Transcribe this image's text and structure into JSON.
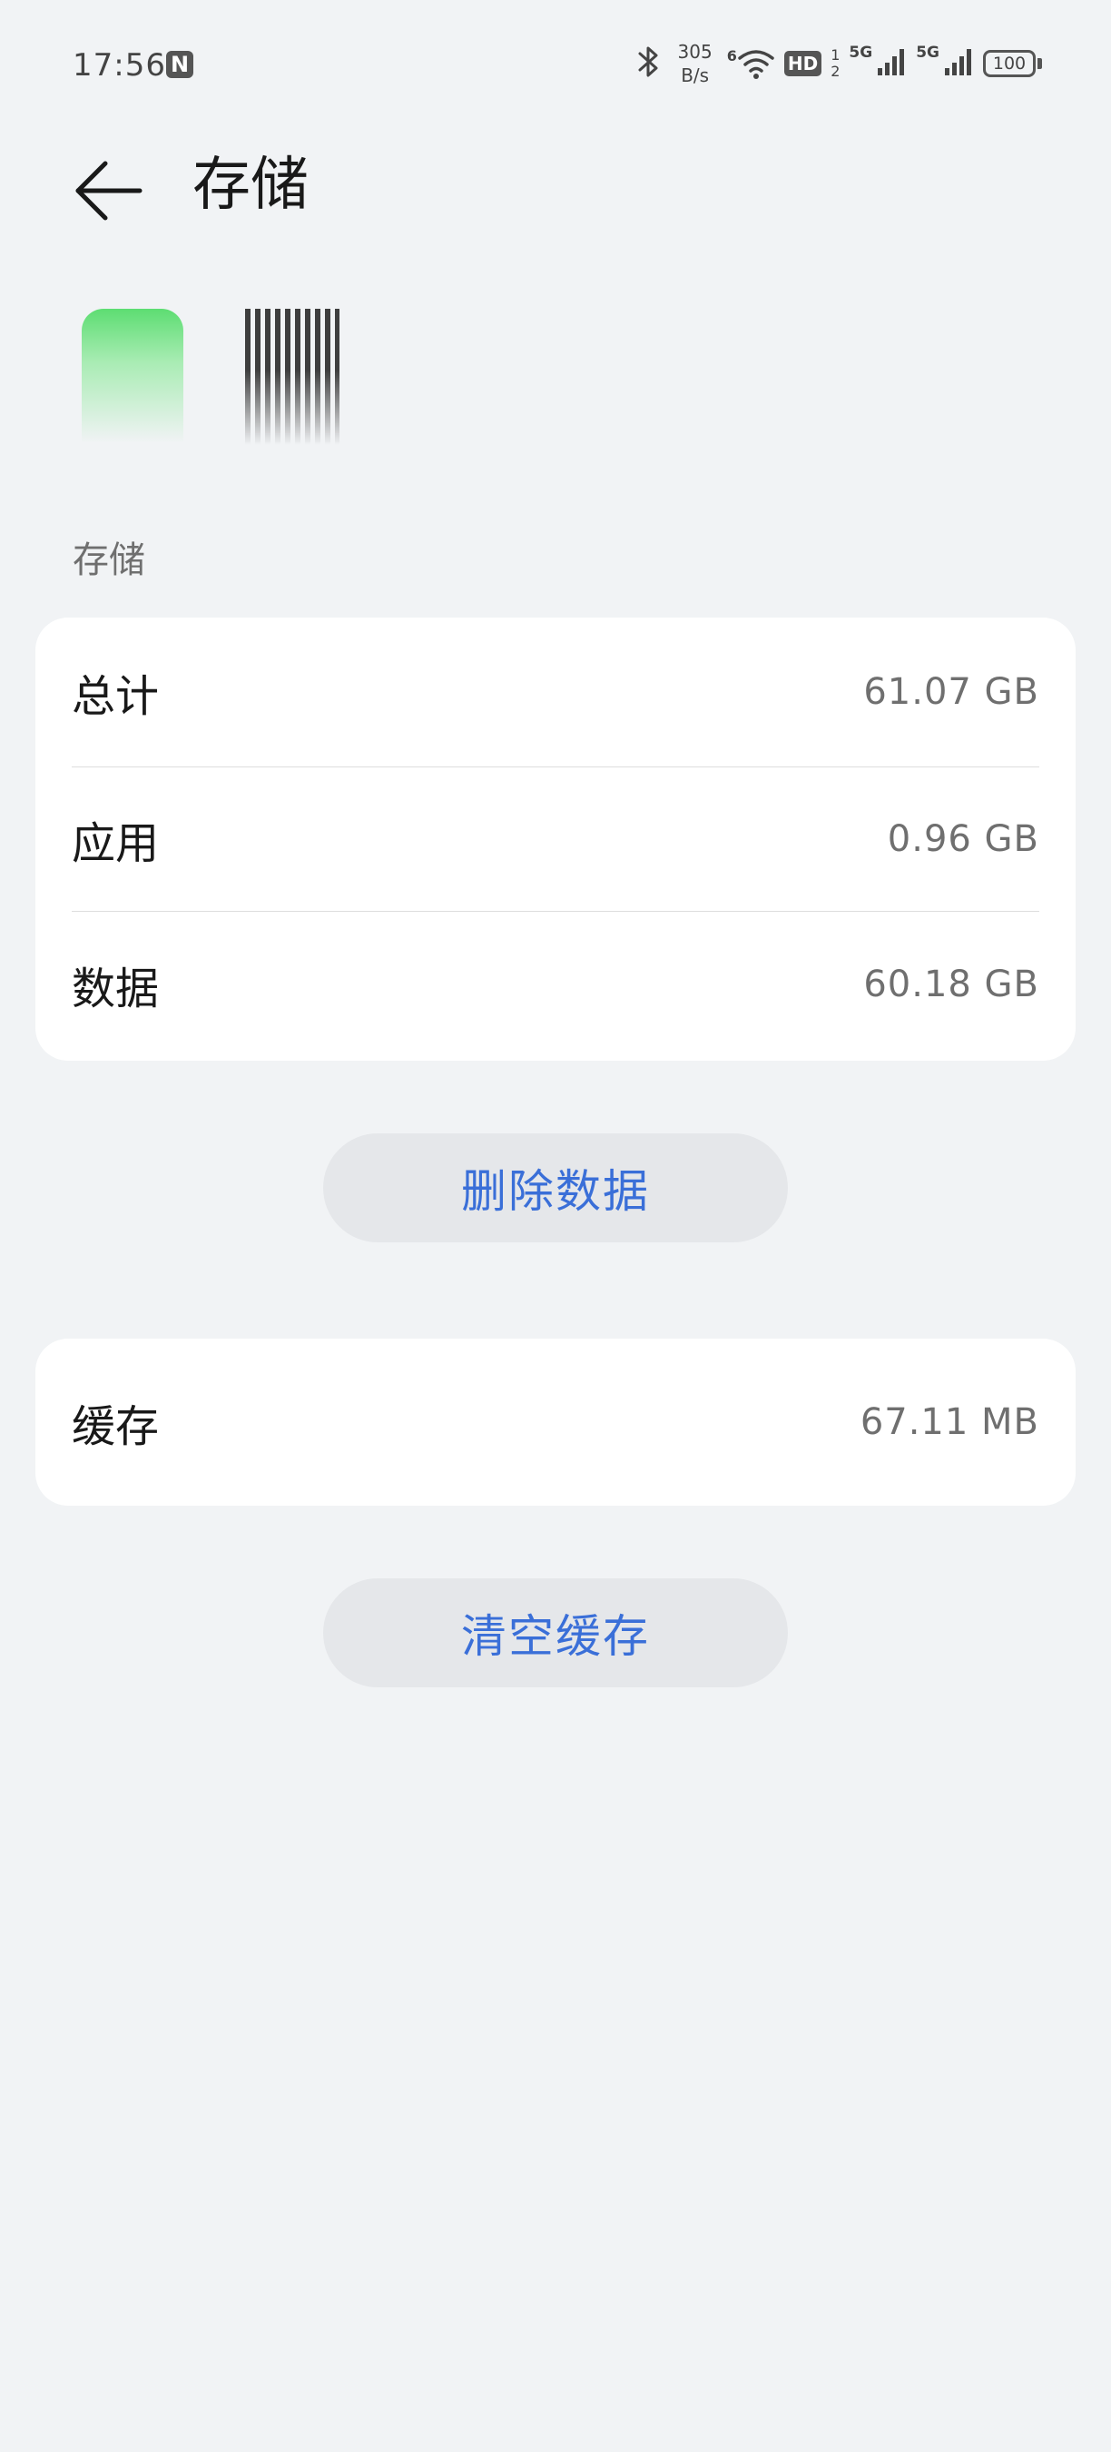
{
  "status_bar": {
    "time": "17:56",
    "nfc_label": "N",
    "net_speed_value": "305",
    "net_speed_unit": "B/s",
    "wifi_label": "6",
    "hd_label": "HD",
    "sim1": "1",
    "sim2": "2",
    "net_type_1": "5G",
    "net_type_2": "5G",
    "battery": "100"
  },
  "header": {
    "title": "存储"
  },
  "section": {
    "label": "存储"
  },
  "storage": {
    "rows": [
      {
        "label": "总计",
        "value": "61.07 GB"
      },
      {
        "label": "应用",
        "value": "0.96 GB"
      },
      {
        "label": "数据",
        "value": "60.18 GB"
      }
    ]
  },
  "buttons": {
    "delete_data": "删除数据",
    "clear_cache": "清空缓存"
  },
  "cache": {
    "label": "缓存",
    "value": "67.11 MB"
  },
  "icons": {
    "back": "arrow-left-icon",
    "bluetooth": "bluetooth-icon",
    "wifi": "wifi-icon",
    "signal": "signal-icon",
    "battery": "battery-icon",
    "app": "app-icon"
  },
  "colors": {
    "background": "#f1f3f5",
    "card": "#ffffff",
    "accent": "#3a6fd8",
    "button_bg": "#e5e7ea",
    "app_icon": "#5ddd72"
  }
}
